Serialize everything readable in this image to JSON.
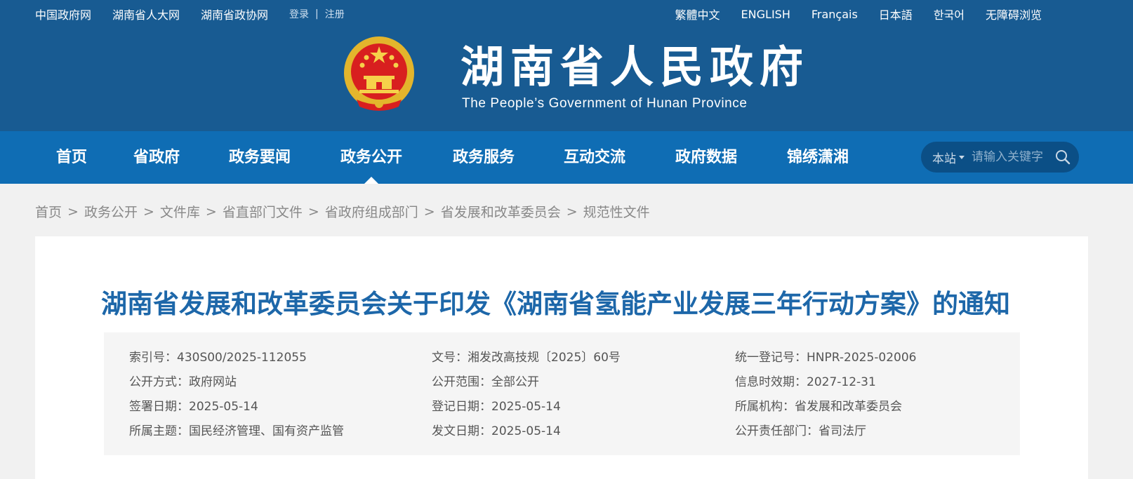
{
  "top_links": {
    "left": [
      "中国政府网",
      "湖南省人大网",
      "湖南省政协网"
    ],
    "login": "登录",
    "separator": "|",
    "register": "注册",
    "languages": [
      "繁體中文",
      "ENGLISH",
      "Français",
      "日本語",
      "한국어",
      "无障碍浏览"
    ]
  },
  "header": {
    "title": "湖南省人民政府",
    "subtitle": "The People’s Government of Hunan Province"
  },
  "nav": {
    "items": [
      "首页",
      "省政府",
      "政务要闻",
      "政务公开",
      "政务服务",
      "互动交流",
      "政府数据",
      "锦绣潇湘"
    ],
    "active_index": 3,
    "search_scope": "本站",
    "search_placeholder": "请输入关键字"
  },
  "breadcrumb": [
    "首页",
    "政务公开",
    "文件库",
    "省直部门文件",
    "省政府组成部门",
    "省发展和改革委员会",
    "规范性文件"
  ],
  "breadcrumb_separator": ">",
  "document": {
    "title": "湖南省发展和改革委员会关于印发《湖南省氢能产业发展三年行动方案》的通知",
    "meta": {
      "col1": [
        "索引号：430S00/2025-112055",
        "公开方式：政府网站",
        "签署日期：2025-05-14",
        "所属主题：国民经济管理、国有资产监管"
      ],
      "col2": [
        "文号：湘发改高技规〔2025〕60号",
        "公开范围：全部公开",
        "登记日期：2025-05-14",
        "发文日期：2025-05-14"
      ],
      "col3": [
        "统一登记号：HNPR-2025-02006",
        "信息时效期：2027-12-31",
        "所属机构：省发展和改革委员会",
        "公开责任部门：省司法厅"
      ]
    }
  },
  "colors": {
    "header_bg": "#185b92",
    "nav_bg": "#0f6db4",
    "title_blue": "#1d67a9",
    "page_bg": "#f1f1f1"
  },
  "icons": [
    "national-emblem-icon",
    "search-icon",
    "caret-down-icon"
  ]
}
